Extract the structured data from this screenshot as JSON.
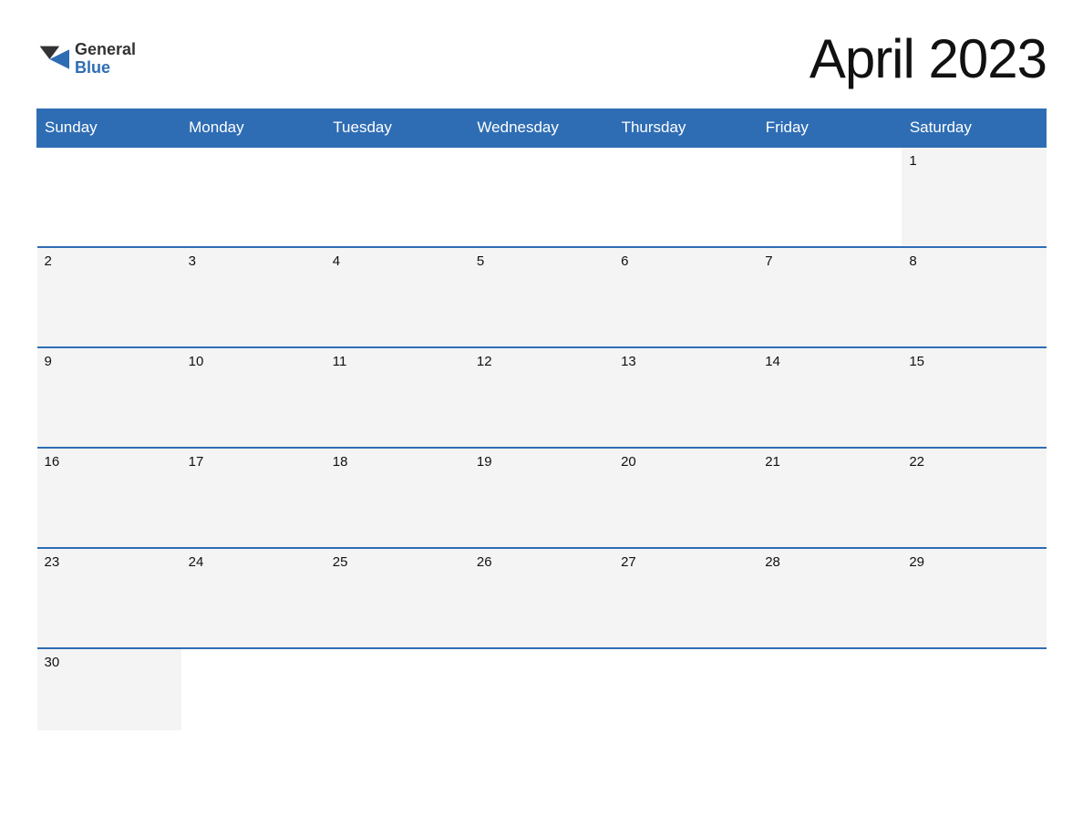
{
  "header": {
    "title": "April 2023",
    "logo_general": "General",
    "logo_blue": "Blue"
  },
  "weekdays": [
    "Sunday",
    "Monday",
    "Tuesday",
    "Wednesday",
    "Thursday",
    "Friday",
    "Saturday"
  ],
  "weeks": [
    [
      {
        "day": "",
        "empty": true
      },
      {
        "day": "",
        "empty": true
      },
      {
        "day": "",
        "empty": true
      },
      {
        "day": "",
        "empty": true
      },
      {
        "day": "",
        "empty": true
      },
      {
        "day": "",
        "empty": true
      },
      {
        "day": "1",
        "empty": false
      }
    ],
    [
      {
        "day": "2",
        "empty": false
      },
      {
        "day": "3",
        "empty": false
      },
      {
        "day": "4",
        "empty": false
      },
      {
        "day": "5",
        "empty": false
      },
      {
        "day": "6",
        "empty": false
      },
      {
        "day": "7",
        "empty": false
      },
      {
        "day": "8",
        "empty": false
      }
    ],
    [
      {
        "day": "9",
        "empty": false
      },
      {
        "day": "10",
        "empty": false
      },
      {
        "day": "11",
        "empty": false
      },
      {
        "day": "12",
        "empty": false
      },
      {
        "day": "13",
        "empty": false
      },
      {
        "day": "14",
        "empty": false
      },
      {
        "day": "15",
        "empty": false
      }
    ],
    [
      {
        "day": "16",
        "empty": false
      },
      {
        "day": "17",
        "empty": false
      },
      {
        "day": "18",
        "empty": false
      },
      {
        "day": "19",
        "empty": false
      },
      {
        "day": "20",
        "empty": false
      },
      {
        "day": "21",
        "empty": false
      },
      {
        "day": "22",
        "empty": false
      }
    ],
    [
      {
        "day": "23",
        "empty": false
      },
      {
        "day": "24",
        "empty": false
      },
      {
        "day": "25",
        "empty": false
      },
      {
        "day": "26",
        "empty": false
      },
      {
        "day": "27",
        "empty": false
      },
      {
        "day": "28",
        "empty": false
      },
      {
        "day": "29",
        "empty": false
      }
    ],
    [
      {
        "day": "30",
        "empty": false
      },
      {
        "day": "",
        "empty": true
      },
      {
        "day": "",
        "empty": true
      },
      {
        "day": "",
        "empty": true
      },
      {
        "day": "",
        "empty": true
      },
      {
        "day": "",
        "empty": true
      },
      {
        "day": "",
        "empty": true
      }
    ]
  ]
}
